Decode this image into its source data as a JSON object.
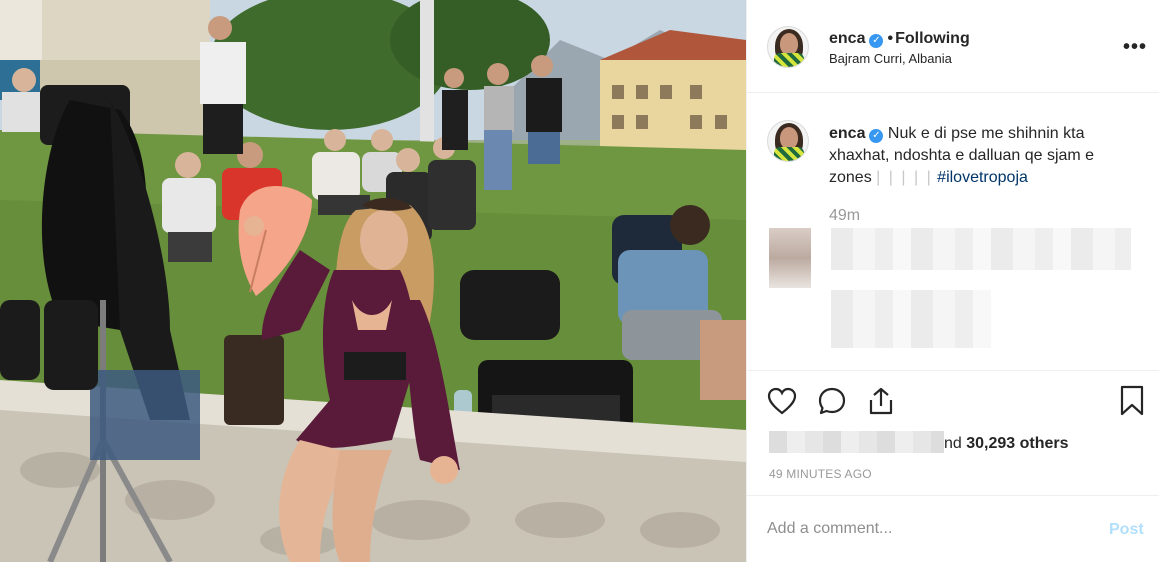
{
  "post": {
    "username": "enca",
    "verified": true,
    "separator": "•",
    "follow_status": "Following",
    "location": "Bajram Curri, Albania",
    "more_icon": "more-horizontal-icon"
  },
  "caption": {
    "username": "enca",
    "text": "Nuk e di pse me shihnin kta xhaxhat, ndoshta e dalluan qe sjam e zones",
    "decoration": "| | | | |",
    "hashtag": "#ilovetropoja",
    "time_ago": "49m"
  },
  "actions": {
    "like_icon": "heart-icon",
    "comment_icon": "comment-bubble-icon",
    "share_icon": "share-upload-icon",
    "save_icon": "bookmark-icon"
  },
  "likes": {
    "suffix": "nd ",
    "count": "30,293 others"
  },
  "timestamp": "49 MINUTES AGO",
  "comment_box": {
    "placeholder": "Add a comment...",
    "post_label": "Post"
  },
  "colors": {
    "verified": "#3897f0",
    "hashtag": "#003569",
    "post_disabled": "#b2dffc",
    "muted": "#999999"
  }
}
